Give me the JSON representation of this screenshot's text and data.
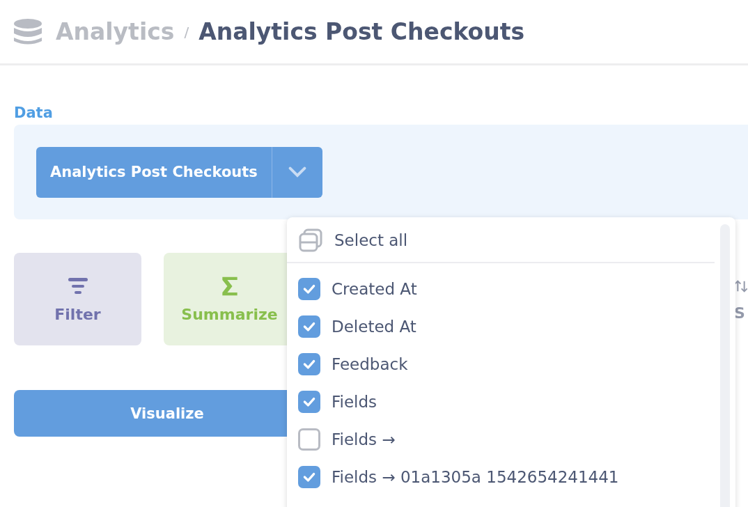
{
  "breadcrumb": {
    "parent": "Analytics",
    "separator": "/",
    "title": "Analytics Post Checkouts"
  },
  "data_section": {
    "label": "Data",
    "table_button": "Analytics Post Checkouts"
  },
  "actions": [
    {
      "kind": "filter",
      "label": "Filter"
    },
    {
      "kind": "summarize",
      "label": "Summarize"
    },
    {
      "kind": "sort",
      "label": "S"
    }
  ],
  "visualize_button": "Visualize",
  "column_picker": {
    "select_all": "Select all",
    "items": [
      {
        "label": "Created At",
        "checked": true
      },
      {
        "label": "Deleted At",
        "checked": true
      },
      {
        "label": "Feedback",
        "checked": true
      },
      {
        "label": "Fields",
        "checked": true
      },
      {
        "label": "Fields →",
        "checked": false
      },
      {
        "label": "Fields → 01a1305a 1542654241441",
        "checked": true
      }
    ]
  }
}
